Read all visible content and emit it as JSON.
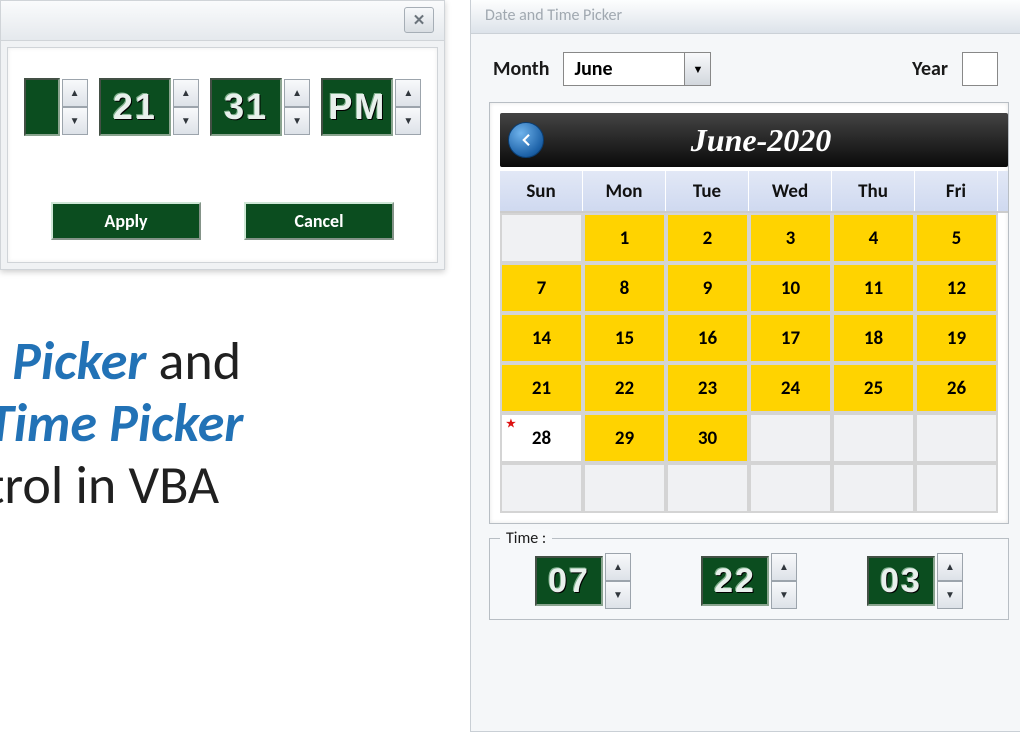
{
  "timepicker": {
    "spinners": [
      {
        "value": "",
        "partial": true
      },
      {
        "value": "21"
      },
      {
        "value": "31"
      },
      {
        "value": "PM"
      }
    ],
    "apply_label": "Apply",
    "cancel_label": "Cancel"
  },
  "headline": {
    "part1": "me Picker",
    "part2": " and",
    "part3": "te Time Picker",
    "part4": "ontrol in VBA"
  },
  "datepicker": {
    "window_title": "Date and Time Picker",
    "month_label": "Month",
    "year_label": "Year",
    "month_value": "June",
    "cal_title": "June-2020",
    "dow": [
      "Sun",
      "Mon",
      "Tue",
      "Wed",
      "Thu",
      "Fri"
    ],
    "days": [
      {
        "d": "",
        "t": "dim"
      },
      {
        "d": "1",
        "t": "active"
      },
      {
        "d": "2",
        "t": "active"
      },
      {
        "d": "3",
        "t": "active"
      },
      {
        "d": "4",
        "t": "active"
      },
      {
        "d": "5",
        "t": "active"
      },
      {
        "d": "7",
        "t": "active"
      },
      {
        "d": "8",
        "t": "active"
      },
      {
        "d": "9",
        "t": "active"
      },
      {
        "d": "10",
        "t": "active"
      },
      {
        "d": "11",
        "t": "active"
      },
      {
        "d": "12",
        "t": "active"
      },
      {
        "d": "14",
        "t": "active"
      },
      {
        "d": "15",
        "t": "active"
      },
      {
        "d": "16",
        "t": "active"
      },
      {
        "d": "17",
        "t": "active"
      },
      {
        "d": "18",
        "t": "active"
      },
      {
        "d": "19",
        "t": "active"
      },
      {
        "d": "21",
        "t": "active"
      },
      {
        "d": "22",
        "t": "active"
      },
      {
        "d": "23",
        "t": "active"
      },
      {
        "d": "24",
        "t": "active"
      },
      {
        "d": "25",
        "t": "active"
      },
      {
        "d": "26",
        "t": "active"
      },
      {
        "d": "28",
        "t": "today"
      },
      {
        "d": "29",
        "t": "active"
      },
      {
        "d": "30",
        "t": "active"
      },
      {
        "d": "",
        "t": "dim"
      },
      {
        "d": "",
        "t": "dim"
      },
      {
        "d": "",
        "t": "dim"
      },
      {
        "d": "",
        "t": "dim"
      },
      {
        "d": "",
        "t": "dim"
      },
      {
        "d": "",
        "t": "dim"
      },
      {
        "d": "",
        "t": "dim"
      },
      {
        "d": "",
        "t": "dim"
      },
      {
        "d": "",
        "t": "dim"
      }
    ],
    "time_legend": "Time :",
    "time_spinners": [
      "07",
      "22",
      "03"
    ]
  }
}
